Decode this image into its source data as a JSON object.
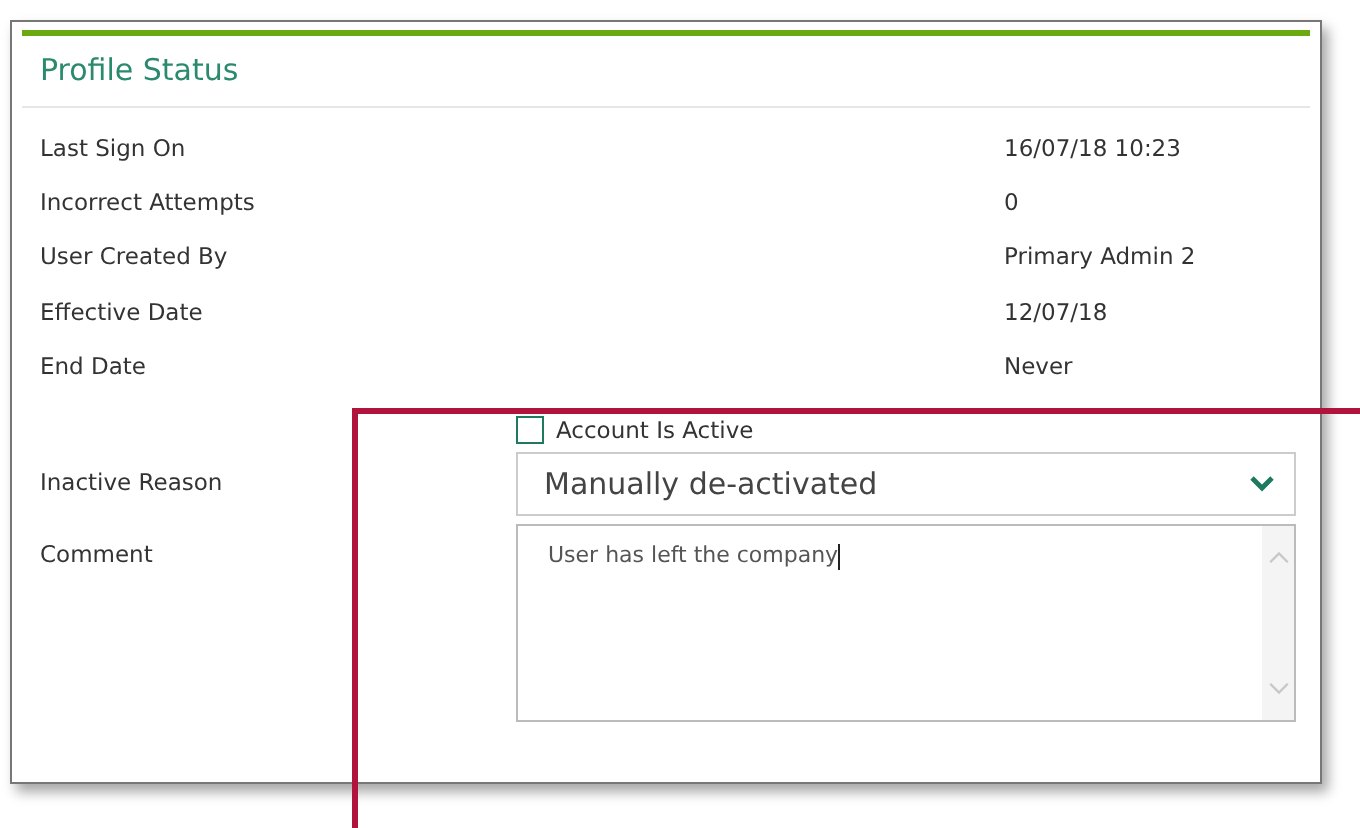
{
  "panel": {
    "title": "Profile Status"
  },
  "fields": [
    {
      "label": "Last Sign On",
      "value": "16/07/18 10:23"
    },
    {
      "label": "Incorrect Attempts",
      "value": "0"
    },
    {
      "label": "User Created By",
      "value": "Primary Admin 2"
    },
    {
      "label": "Effective Date",
      "value": "12/07/18"
    },
    {
      "label": "End Date",
      "value": "Never"
    }
  ],
  "account_active": {
    "label": "Account Is Active",
    "checked": false
  },
  "inactive_reason": {
    "label": "Inactive Reason",
    "value": "Manually de-activated"
  },
  "comment": {
    "label": "Comment",
    "value": "User has left the company"
  }
}
